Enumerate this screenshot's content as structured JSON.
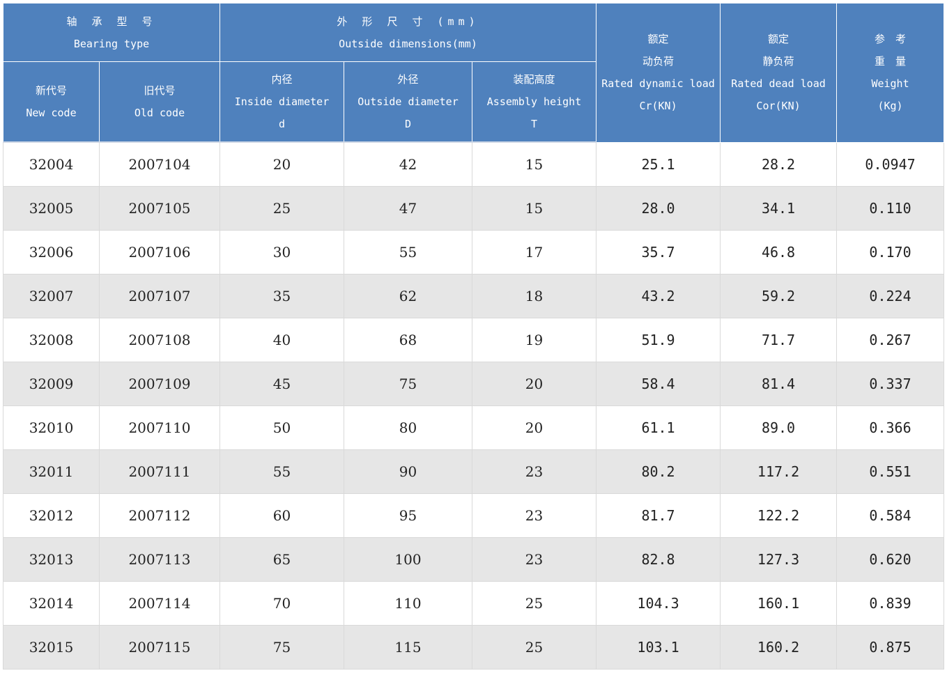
{
  "header": {
    "bearing_type_cn": "轴 承 型 号",
    "bearing_type_en": "Bearing type",
    "outside_dims_cn": "外 形 尺 寸 (mm)",
    "outside_dims_en": "Outside dimensions(mm)",
    "dynamic_cn1": "额定",
    "dynamic_cn2": "动负荷",
    "dynamic_en": "Rated dynamic load",
    "dynamic_unit": "Cr(KN)",
    "static_cn1": "额定",
    "static_cn2": "静负荷",
    "static_en": "Rated dead load",
    "static_unit": "Cor(KN)",
    "weight_cn1": "参　考",
    "weight_cn2": "重　量",
    "weight_en": "Weight",
    "weight_unit": "(Kg)",
    "new_code_cn": "新代号",
    "new_code_en": "New code",
    "old_code_cn": "旧代号",
    "old_code_en": "Old code",
    "inside_cn": "内径",
    "inside_en": "Inside diameter",
    "inside_sym": "d",
    "outside_cn": "外径",
    "outside_en": "Outside diameter",
    "outside_sym": "D",
    "assembly_cn": "装配高度",
    "assembly_en": "Assembly height",
    "assembly_sym": "T"
  },
  "rows": [
    {
      "new": "32004",
      "old": "2007104",
      "d": "20",
      "D": "42",
      "T": "15",
      "cr": "25.1",
      "cor": "28.2",
      "w": "0.0947"
    },
    {
      "new": "32005",
      "old": "2007105",
      "d": "25",
      "D": "47",
      "T": "15",
      "cr": "28.0",
      "cor": "34.1",
      "w": "0.110"
    },
    {
      "new": "32006",
      "old": "2007106",
      "d": "30",
      "D": "55",
      "T": "17",
      "cr": "35.7",
      "cor": "46.8",
      "w": "0.170"
    },
    {
      "new": "32007",
      "old": "2007107",
      "d": "35",
      "D": "62",
      "T": "18",
      "cr": "43.2",
      "cor": "59.2",
      "w": "0.224"
    },
    {
      "new": "32008",
      "old": "2007108",
      "d": "40",
      "D": "68",
      "T": "19",
      "cr": "51.9",
      "cor": "71.7",
      "w": "0.267"
    },
    {
      "new": "32009",
      "old": "2007109",
      "d": "45",
      "D": "75",
      "T": "20",
      "cr": "58.4",
      "cor": "81.4",
      "w": "0.337"
    },
    {
      "new": "32010",
      "old": "2007110",
      "d": "50",
      "D": "80",
      "T": "20",
      "cr": "61.1",
      "cor": "89.0",
      "w": "0.366"
    },
    {
      "new": "32011",
      "old": "2007111",
      "d": "55",
      "D": "90",
      "T": "23",
      "cr": "80.2",
      "cor": "117.2",
      "w": "0.551"
    },
    {
      "new": "32012",
      "old": "2007112",
      "d": "60",
      "D": "95",
      "T": "23",
      "cr": "81.7",
      "cor": "122.2",
      "w": "0.584"
    },
    {
      "new": "32013",
      "old": "2007113",
      "d": "65",
      "D": "100",
      "T": "23",
      "cr": "82.8",
      "cor": "127.3",
      "w": "0.620"
    },
    {
      "new": "32014",
      "old": "2007114",
      "d": "70",
      "D": "110",
      "T": "25",
      "cr": "104.3",
      "cor": "160.1",
      "w": "0.839"
    },
    {
      "new": "32015",
      "old": "2007115",
      "d": "75",
      "D": "115",
      "T": "25",
      "cr": "103.1",
      "cor": "160.2",
      "w": "0.875"
    }
  ]
}
